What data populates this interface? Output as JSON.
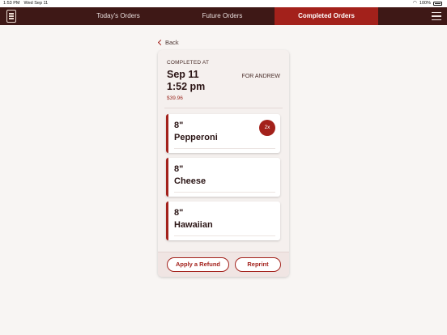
{
  "status_bar": {
    "time": "1:53 PM",
    "date": "Wed Sep 11",
    "battery": "100%"
  },
  "nav": {
    "tabs": [
      {
        "label": "Today's Orders",
        "active": false
      },
      {
        "label": "Future Orders",
        "active": false
      },
      {
        "label": "Completed Orders",
        "active": true
      }
    ],
    "logo_icon": "store-logo-icon",
    "menu_icon": "hamburger-menu-icon"
  },
  "back_label": "Back",
  "order": {
    "status_label": "COMPLETED AT",
    "date": "Sep 11",
    "time": "1:52 pm",
    "total": "$39.96",
    "customer": "FOR ANDREW",
    "items": [
      {
        "size": "8\"",
        "name": "Pepperoni",
        "quantity": "2x"
      },
      {
        "size": "8\"",
        "name": "Cheese",
        "quantity": ""
      },
      {
        "size": "8\"",
        "name": "Hawaiian",
        "quantity": ""
      }
    ],
    "actions": {
      "refund_label": "Apply a Refund",
      "reprint_label": "Reprint"
    }
  },
  "colors": {
    "nav_bg": "#3e1816",
    "accent": "#a3211b",
    "page_bg": "#f8f5f3"
  }
}
